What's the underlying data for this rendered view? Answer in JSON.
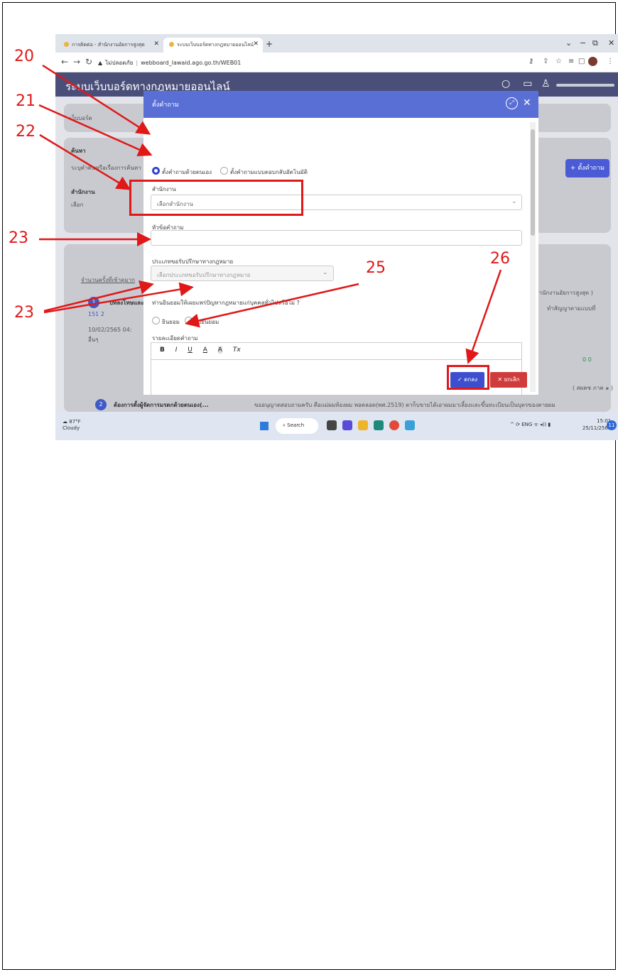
{
  "browser": {
    "tabs": [
      {
        "label": "การติดต่อ - สำนักงานอัยการสูงสุด",
        "active": false
      },
      {
        "label": "ระบบเว็บบอร์ดทางกฎหมายออนไลน์",
        "active": true
      }
    ],
    "address": {
      "security_label": "ไม่ปลอดภัย",
      "url": "webboard_lawaid.ago.go.th/WEB01"
    }
  },
  "app": {
    "title": "ระบบเว็บบอร์ดทางกฎหมายออนไลน์",
    "breadcrumb": "เว็บบอร์ด",
    "add_question_button": "+ ตั้งคำถาม",
    "search_label": "ค้นหา",
    "search_placeholder": "ระบุคำค้นหรือเรื่องการค้นหา",
    "office_label": "สำนักงาน",
    "office_value": "เลือก",
    "stats_tab": "จำนวนครั้งที่เข้าดูมาก",
    "card1_title": "บทลงโทษและ",
    "card1_stats": "151  2",
    "card1_date": "10/02/2565 04:",
    "card1_tag": "อื่นๆ",
    "card2_num": "2",
    "card2_title": "ต้องการตั้งผู้จัดการมรดกด้วยตนเอง(...",
    "right_office": "( สำนักงานอัยการสูงสุด )",
    "right_text": "ทำสัญญาตามแบบที่",
    "right_stats": "0  0",
    "right_region": "( สผคช ภาค ๑ )",
    "bottom_text": "ขออนุญาตสอบถามครับ คือแม่ผมท้องผม พอคลอด(พศ.2519) ตาก็บขายได้เอาผมมาเลี้ยงและขึ้นทะเบียนเป็นบุตรของตายผม"
  },
  "dialog": {
    "title": "ตั้งคำถาม",
    "radio_self": "ตั้งคำถามด้วยตนเอง",
    "radio_auto": "ตั้งคำถามแบบตอบกลับอัตโนมัติ",
    "office_label": "สำนักงาน",
    "office_placeholder": "เลือกสำนักงาน",
    "subject_label": "หัวข้อคำถาม",
    "subject_value": "",
    "legal_type_label": "ประเภทขอรับปรึกษาทางกฎหมาย",
    "legal_type_placeholder": "เลือกประเภทขอรับปรึกษาทางกฎหมาย",
    "consent_question": "ท่านยินยอมให้เผยแพร่ปัญหากฎหมายแก่บุคคลทั่วไปหรือไม่ ?",
    "consent_yes": "ยินยอม",
    "consent_no": "ไม่ยินยอม",
    "detail_label": "รายละเอียดคำถาม",
    "toolbar": [
      "B",
      "I",
      "U",
      "A",
      "A",
      "Tx"
    ],
    "ok_button": "✓ ตกลง",
    "cancel_button": "✕ ยกเลิก"
  },
  "taskbar": {
    "weather_temp": "87°F",
    "weather_desc": "Cloudy",
    "search_label": "Search",
    "lang": "ENG",
    "time": "15:01",
    "date": "25/11/2565",
    "notifications": "11"
  },
  "annotations": {
    "n20": "20",
    "n21": "21",
    "n22": "22",
    "n23a": "23",
    "n23b": "23",
    "n25": "25",
    "n26": "26"
  },
  "colors": {
    "annotation": "#e01818",
    "dialog_header": "#5a6fd6",
    "ok": "#3d4fcf",
    "cancel": "#d03b3b"
  }
}
